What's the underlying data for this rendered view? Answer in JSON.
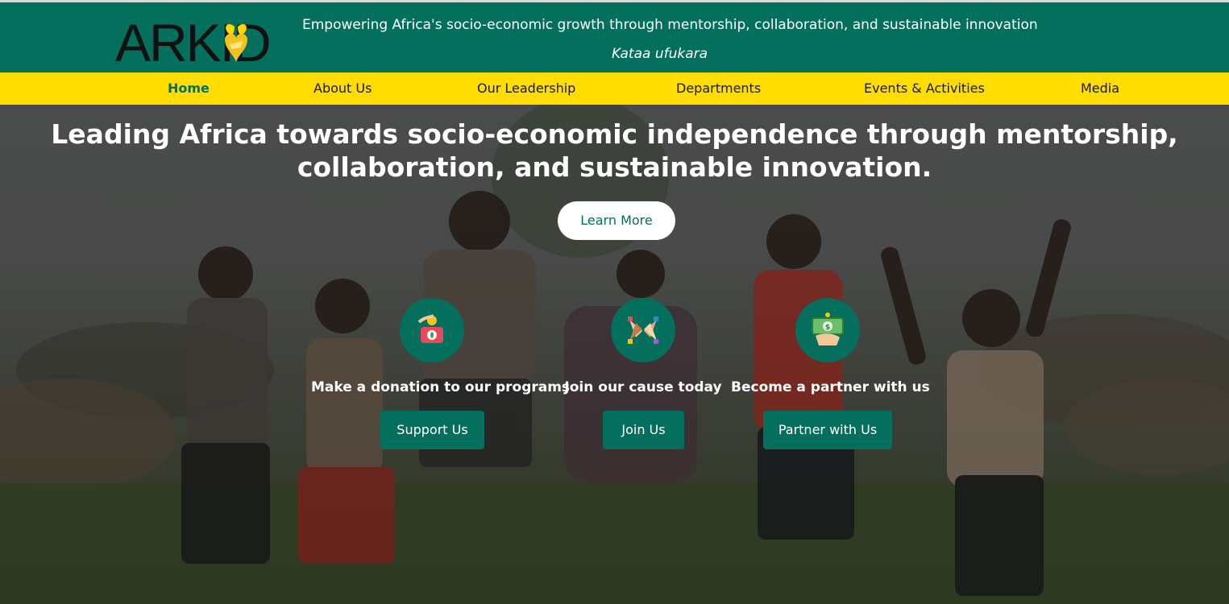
{
  "header": {
    "logo_text": "ARKID",
    "tagline": "Empowering Africa's socio-economic growth through mentorship, collaboration, and sustainable innovation",
    "motto": "Kataa ufukara"
  },
  "nav": {
    "items": [
      {
        "label": "Home",
        "active": true
      },
      {
        "label": "About Us"
      },
      {
        "label": "Our Leadership"
      },
      {
        "label": "Departments"
      },
      {
        "label": "Events & Activities"
      },
      {
        "label": "Media"
      }
    ]
  },
  "hero": {
    "title_line1": "Leading Africa towards socio-economic independence through mentorship,",
    "title_line2": "collaboration, and sustainable innovation.",
    "learn_more": "Learn More",
    "ctas": [
      {
        "icon": "donation-icon",
        "text": "Make a donation to our programs",
        "button": "Support Us"
      },
      {
        "icon": "joined-hands-icon",
        "text": "Join our cause today",
        "button": "Join Us"
      },
      {
        "icon": "money-hand-icon",
        "text": "Become a partner with us",
        "button": "Partner with Us"
      }
    ]
  },
  "colors": {
    "brand_green": "#046f5c",
    "brand_yellow": "#ffdd00",
    "white": "#ffffff"
  }
}
